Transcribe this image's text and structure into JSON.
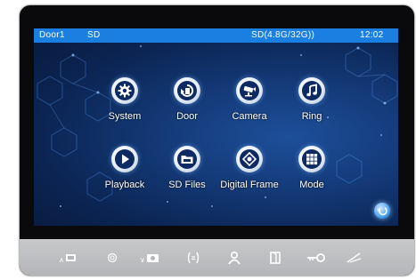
{
  "statusbar": {
    "door": "Door1",
    "storage": "SD",
    "capacity": "SD(4.8G/32G))",
    "time": "12:02"
  },
  "apps": [
    {
      "label": "System",
      "icon": "gear-icon"
    },
    {
      "label": "Door",
      "icon": "door-return-icon"
    },
    {
      "label": "Camera",
      "icon": "camera-icon"
    },
    {
      "label": "Ring",
      "icon": "music-note-icon"
    },
    {
      "label": "Playback",
      "icon": "play-icon"
    },
    {
      "label": "SD Files",
      "icon": "folder-icon"
    },
    {
      "label": "Digital Frame",
      "icon": "photo-frame-icon"
    },
    {
      "label": "Mode",
      "icon": "grid-icon"
    }
  ],
  "back_icon": "back-arrow-icon",
  "bottom_buttons": [
    {
      "icon": "up-monitor-icon",
      "label": "∧"
    },
    {
      "icon": "settings-ring-icon",
      "label": ""
    },
    {
      "icon": "down-camera-icon",
      "label": "∨"
    },
    {
      "icon": "intercom-icon",
      "label": ""
    },
    {
      "icon": "person-icon",
      "label": ""
    },
    {
      "icon": "door-icon",
      "label": ""
    },
    {
      "icon": "key-icon",
      "label": ""
    },
    {
      "icon": "hangup-icon",
      "label": ""
    }
  ],
  "colors": {
    "statusbar": "#1a7fe0",
    "bezel": "#0a0a0c",
    "bottombar": "#c0c1c3"
  }
}
